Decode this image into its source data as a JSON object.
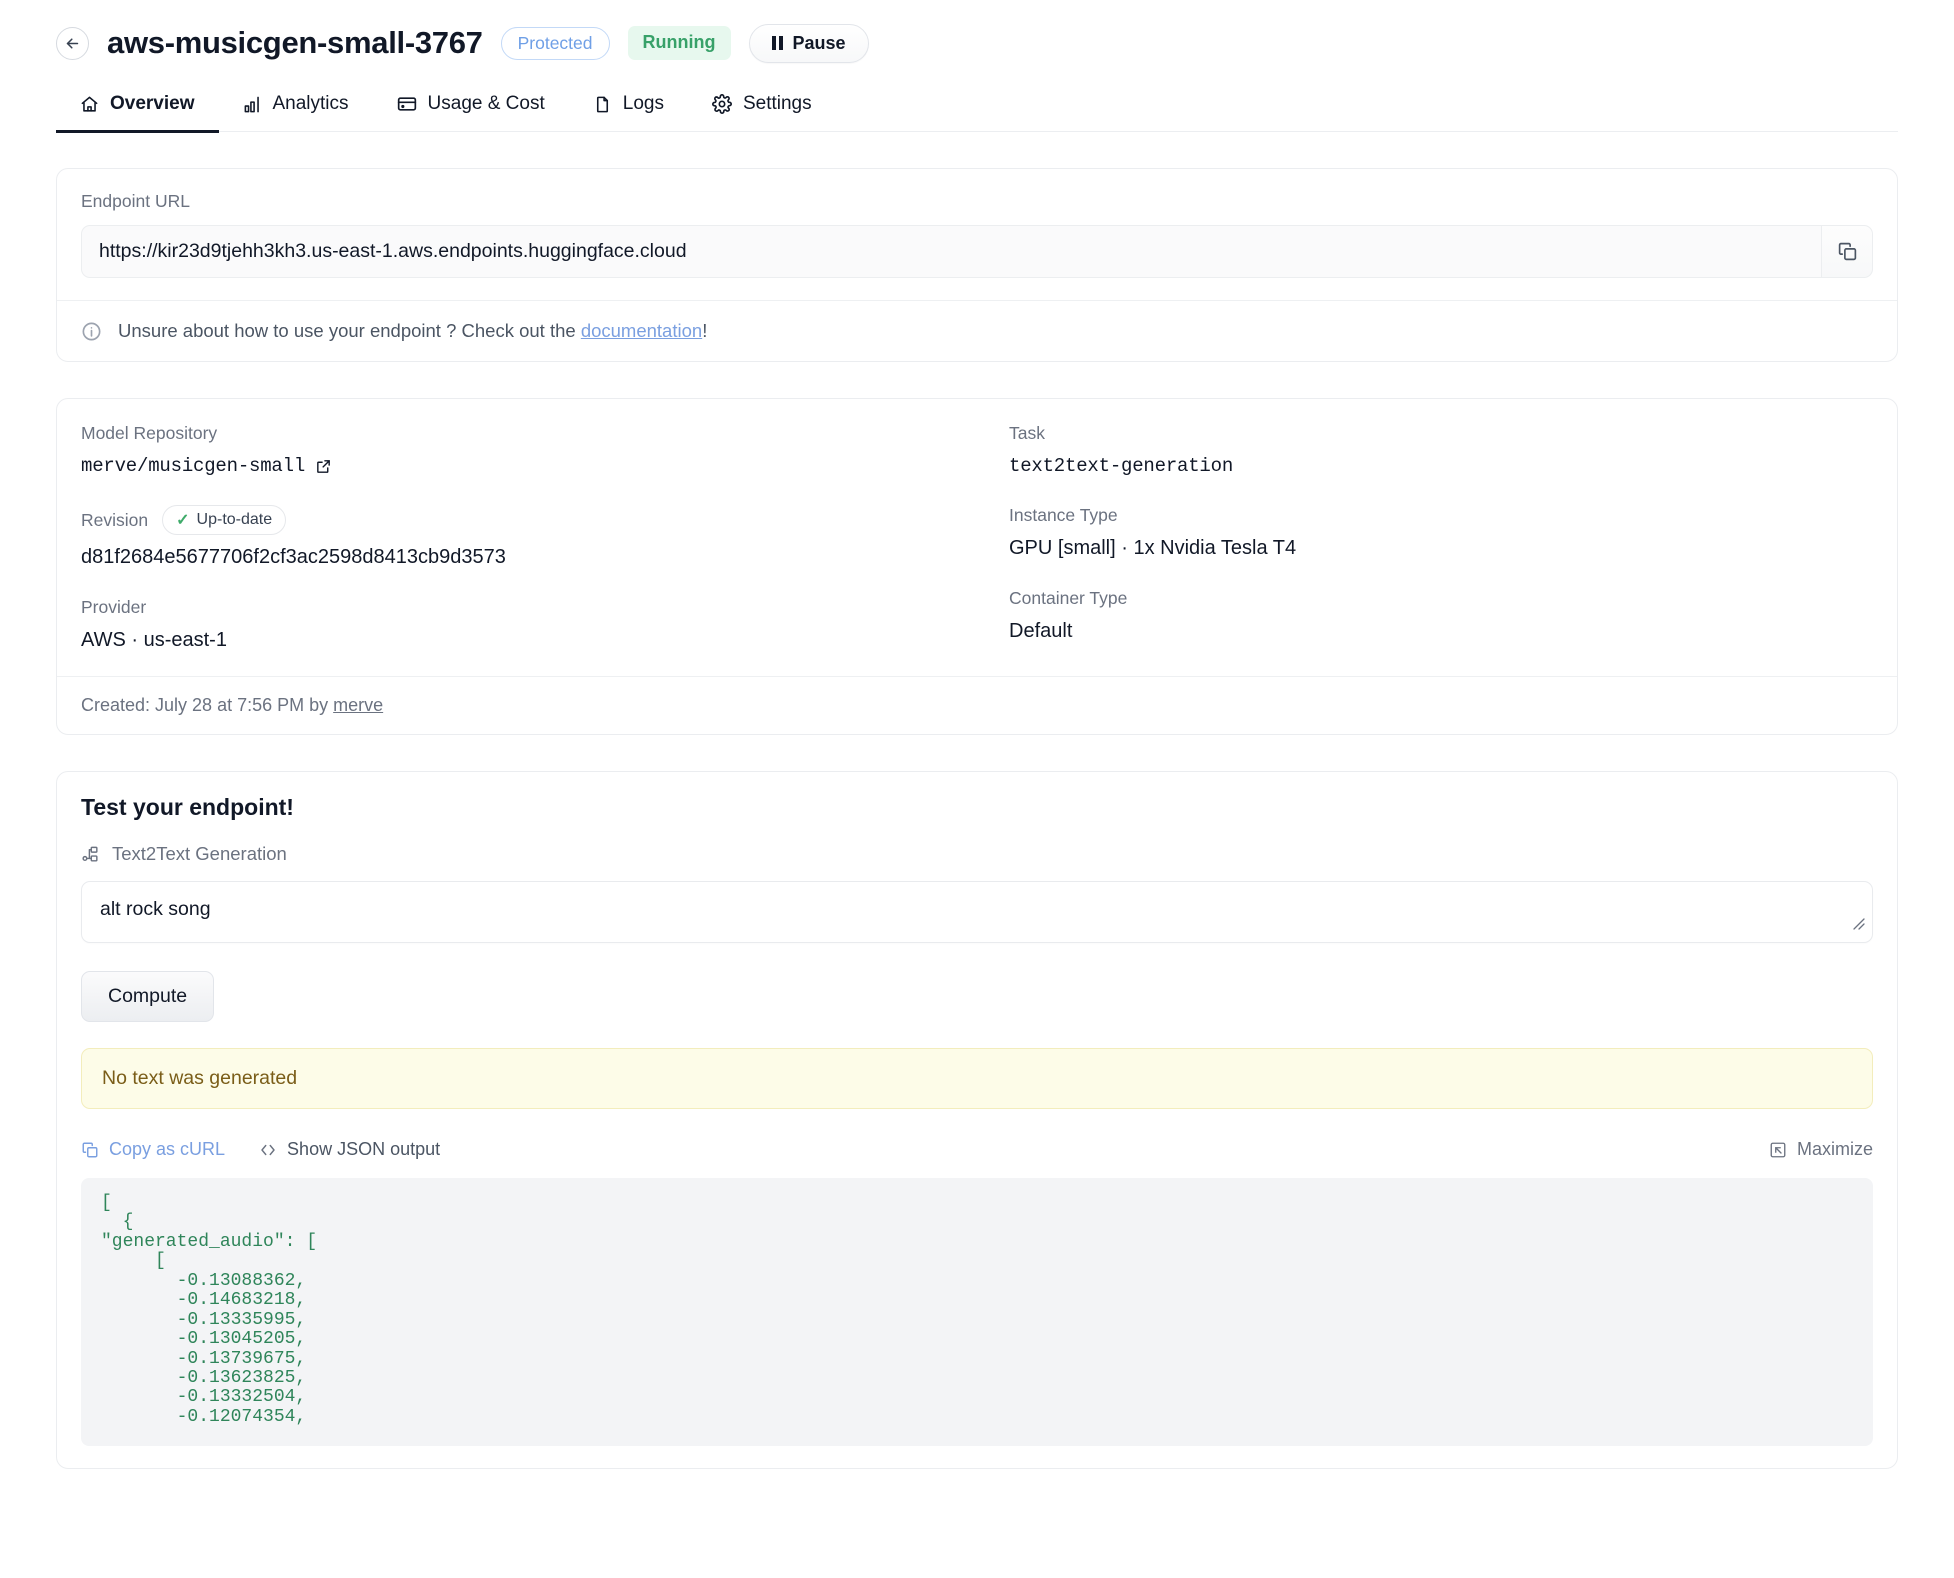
{
  "header": {
    "back_icon": "arrow-left-circle-icon",
    "title": "aws-musicgen-small-3767",
    "protected_badge": "Protected",
    "status_badge": "Running",
    "pause_label": "Pause",
    "colors": {
      "protected_text": "#6f9fe6",
      "protected_border": "#c3d9f7",
      "running_text": "#38a169",
      "running_bg": "#e7f8ee"
    }
  },
  "tabs": [
    {
      "label": "Overview",
      "icon": "home-icon",
      "active": true
    },
    {
      "label": "Analytics",
      "icon": "bar-chart-icon",
      "active": false
    },
    {
      "label": "Usage & Cost",
      "icon": "credit-card-icon",
      "active": false
    },
    {
      "label": "Logs",
      "icon": "file-icon",
      "active": false
    },
    {
      "label": "Settings",
      "icon": "gear-icon",
      "active": false
    }
  ],
  "endpoint": {
    "label": "Endpoint URL",
    "url": "https://kir23d9tjehh3kh3.us-east-1.aws.endpoints.huggingface.cloud",
    "copy_icon": "copy-icon",
    "info_icon": "info-circle-icon",
    "info_prefix": "Unsure about how to use your endpoint ? Check out the ",
    "info_link": "documentation",
    "info_suffix": "!"
  },
  "details": {
    "model_repository_label": "Model Repository",
    "model_repository_value": "merve/musicgen-small",
    "model_repository_link_icon": "external-link-icon",
    "revision_label": "Revision",
    "revision_badge": "Up-to-date",
    "revision_badge_icon": "check-icon",
    "revision_value": "d81f2684e5677706f2cf3ac2598d8413cb9d3573",
    "provider_label": "Provider",
    "provider_value": "AWS · us-east-1",
    "task_label": "Task",
    "task_value": "text2text-generation",
    "instance_type_label": "Instance Type",
    "instance_type_value": "GPU [small] · 1x Nvidia Tesla T4",
    "container_type_label": "Container Type",
    "container_type_value": "Default",
    "created_prefix": "Created: July 28 at 7:56 PM by ",
    "created_author": "merve"
  },
  "test": {
    "heading": "Test your endpoint!",
    "task_icon": "pipeline-icon",
    "task_name": "Text2Text Generation",
    "input_value": "alt rock song",
    "input_placeholder": "",
    "resize_icon": "resize-handle-icon",
    "compute_label": "Compute",
    "warning": "No text was generated",
    "copy_curl_label": "Copy as cURL",
    "copy_curl_icon": "copy-icon",
    "show_json_label": "Show JSON output",
    "show_json_icon": "code-brackets-icon",
    "maximize_label": "Maximize",
    "maximize_icon": "maximize-icon",
    "json_output": "[\n  {\n\"generated_audio\": [\n     [\n       -0.13088362,\n       -0.14683218,\n       -0.13335995,\n       -0.13045205,\n       -0.13739675,\n       -0.13623825,\n       -0.13332504,\n       -0.12074354,"
  }
}
